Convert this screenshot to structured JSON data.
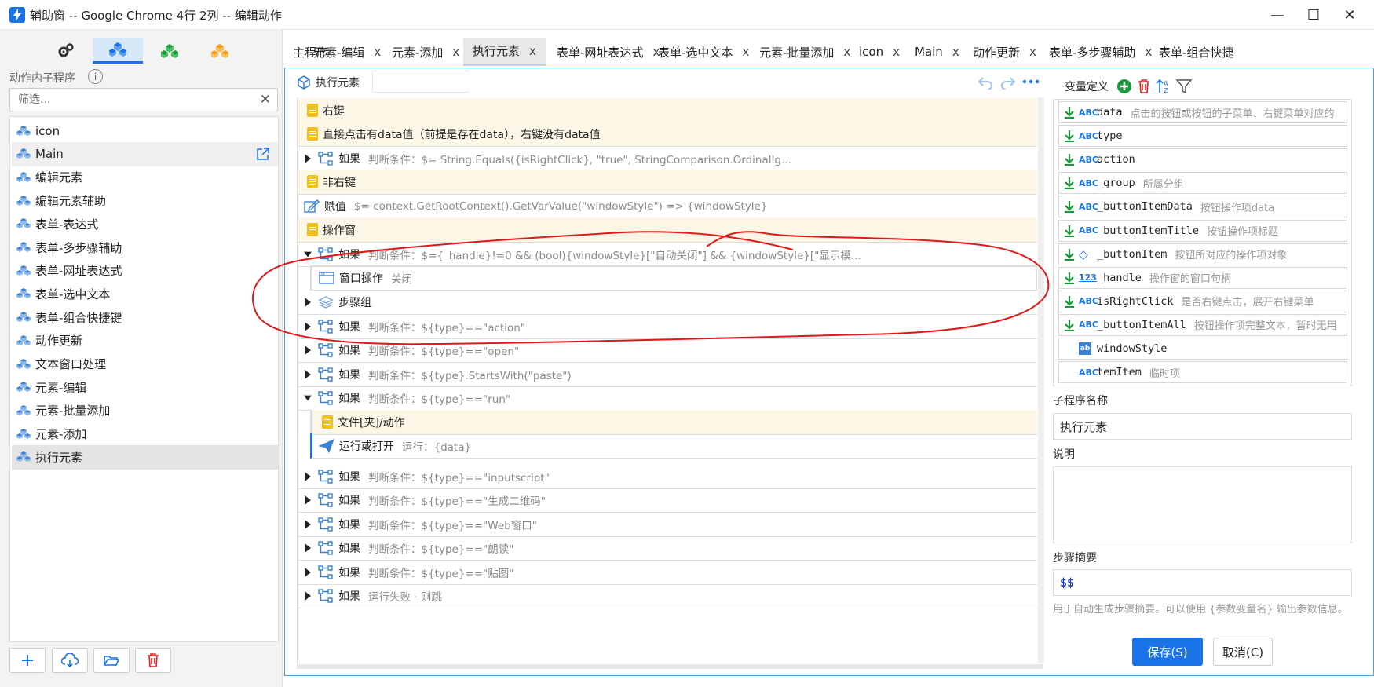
{
  "window": {
    "title": "辅助窗 -- Google Chrome 4行 2列 -- 编辑动作",
    "minimize": "—",
    "maximize": "☐",
    "close": "✕"
  },
  "left": {
    "category_tabs": [
      "gears-icon",
      "cubes-blue-icon",
      "cubes-green-icon",
      "cubes-orange-icon"
    ],
    "subprogram_title": "动作内子程序",
    "info": "i",
    "filter_placeholder": "筛选...",
    "filter_clear": "✕",
    "items": [
      {
        "label": "icon"
      },
      {
        "label": "Main"
      },
      {
        "label": "编辑元素"
      },
      {
        "label": "编辑元素辅助"
      },
      {
        "label": "表单-表达式"
      },
      {
        "label": "表单-多步骤辅助"
      },
      {
        "label": "表单-网址表达式"
      },
      {
        "label": "表单-选中文本"
      },
      {
        "label": "表单-组合快捷键"
      },
      {
        "label": "动作更新"
      },
      {
        "label": "文本窗口处理"
      },
      {
        "label": "元素-编辑"
      },
      {
        "label": "元素-批量添加"
      },
      {
        "label": "元素-添加"
      },
      {
        "label": "执行元素"
      }
    ],
    "bottom_buttons": [
      "add-icon",
      "cloud-download-icon",
      "folder-open-icon",
      "trash-icon"
    ]
  },
  "tabs": [
    {
      "label": "主程序",
      "close": ""
    },
    {
      "label": "元素-编辑",
      "close": "x"
    },
    {
      "label": "元素-添加",
      "close": "x"
    },
    {
      "label": "执行元素",
      "close": "x"
    },
    {
      "label": "表单-网址表达式",
      "close": "x"
    },
    {
      "label": "表单-选中文本",
      "close": "x"
    },
    {
      "label": "元素-批量添加",
      "close": "x"
    },
    {
      "label": "icon",
      "close": "x"
    },
    {
      "label": "Main",
      "close": "x"
    },
    {
      "label": "动作更新",
      "close": "x"
    },
    {
      "label": "表单-多步骤辅助",
      "close": "x"
    },
    {
      "label": "表单-组合快捷",
      "close": ""
    }
  ],
  "editor": {
    "header_label": "执行元素",
    "header_input": ""
  },
  "steps": [
    {
      "kind": "note",
      "label": "右键",
      "cond": ""
    },
    {
      "kind": "note",
      "label": "直接点击有data值（前提是存在data），右键没有data值",
      "cond": ""
    },
    {
      "kind": "if",
      "label": "如果",
      "cond": "判断条件：$= String.Equals({isRightClick}, \"true\", StringComparison.OrdinalIg..."
    },
    {
      "kind": "note",
      "label": "非右键",
      "cond": ""
    },
    {
      "kind": "assign",
      "label": "赋值",
      "cond": "$= context.GetRootContext().GetVarValue(\"windowStyle\") => {windowStyle}"
    },
    {
      "kind": "note",
      "label": "操作窗",
      "cond": ""
    },
    {
      "kind": "if-open",
      "label": "如果",
      "cond": "判断条件：$={_handle}!=0 && (bool){windowStyle}[\"自动关闭\"] && {windowStyle}[\"显示模..."
    },
    {
      "kind": "window",
      "label": "窗口操作",
      "cond": "关闭"
    },
    {
      "kind": "group",
      "label": "步骤组",
      "cond": ""
    },
    {
      "kind": "if",
      "label": "如果",
      "cond": "判断条件：${type}==\"action\""
    },
    {
      "kind": "if",
      "label": "如果",
      "cond": "判断条件：${type}==\"open\""
    },
    {
      "kind": "if",
      "label": "如果",
      "cond": "判断条件：${type}.StartsWith(\"paste\")"
    },
    {
      "kind": "if-open",
      "label": "如果",
      "cond": "判断条件：${type}==\"run\""
    },
    {
      "kind": "subnote",
      "label": "文件[夹]/动作",
      "cond": ""
    },
    {
      "kind": "run",
      "label": "运行或打开",
      "cond": "运行：{data}"
    },
    {
      "kind": "if",
      "label": "如果",
      "cond": "判断条件：${type}==\"inputscript\""
    },
    {
      "kind": "if",
      "label": "如果",
      "cond": "判断条件：${type}==\"生成二维码\""
    },
    {
      "kind": "if",
      "label": "如果",
      "cond": "判断条件：${type}==\"Web窗口\""
    },
    {
      "kind": "if",
      "label": "如果",
      "cond": "判断条件：${type}==\"朗读\""
    },
    {
      "kind": "if",
      "label": "如果",
      "cond": "判断条件：${type}==\"贴图\""
    },
    {
      "kind": "if",
      "label": "如果",
      "cond": "运行失败 · 则跳"
    }
  ],
  "variables": {
    "title": "变量定义",
    "items": [
      {
        "type": "ABC",
        "name": "data",
        "desc": "点击的按钮或按钮的子菜单、右键菜单对应的",
        "dl": true
      },
      {
        "type": "ABC",
        "name": "type",
        "desc": "",
        "dl": true
      },
      {
        "type": "ABC",
        "name": "action",
        "desc": "",
        "dl": true
      },
      {
        "type": "ABC",
        "name": "_group",
        "desc": "所属分组",
        "dl": true
      },
      {
        "type": "ABC",
        "name": "_buttonItemData",
        "desc": "按钮操作项data",
        "dl": true
      },
      {
        "type": "ABC",
        "name": "_buttonItemTitle",
        "desc": "按钮操作项标题",
        "dl": true
      },
      {
        "type": "◇",
        "name": "_buttonItem",
        "desc": "按钮所对应的操作项对象",
        "dl": true
      },
      {
        "type": "123",
        "name": "_handle",
        "desc": "操作窗的窗口句柄",
        "dl": true
      },
      {
        "type": "ABC",
        "name": "isRightClick",
        "desc": "是否右键点击，展开右键菜单",
        "dl": true
      },
      {
        "type": "ABC",
        "name": "_buttonItemAll",
        "desc": "按钮操作项完整文本，暂时无用",
        "dl": true
      },
      {
        "type": "ab",
        "name": "windowStyle",
        "desc": "",
        "dl": false
      },
      {
        "type": "ABC",
        "name": "temItem",
        "desc": "临时项",
        "dl": false
      }
    ]
  },
  "form": {
    "name_label": "子程序名称",
    "name_value": "执行元素",
    "desc_label": "说明",
    "desc_value": "",
    "summary_label": "步骤摘要",
    "summary_value": "$$",
    "hint": "用于自动生成步骤摘要。可以使用 {参数变量名} 输出参数信息。",
    "save": "保存(S)",
    "cancel": "取消(C)"
  },
  "colors": {
    "accent": "#1a73e8",
    "annotation": "#e01818",
    "note_bg": "#fbf6e6"
  }
}
